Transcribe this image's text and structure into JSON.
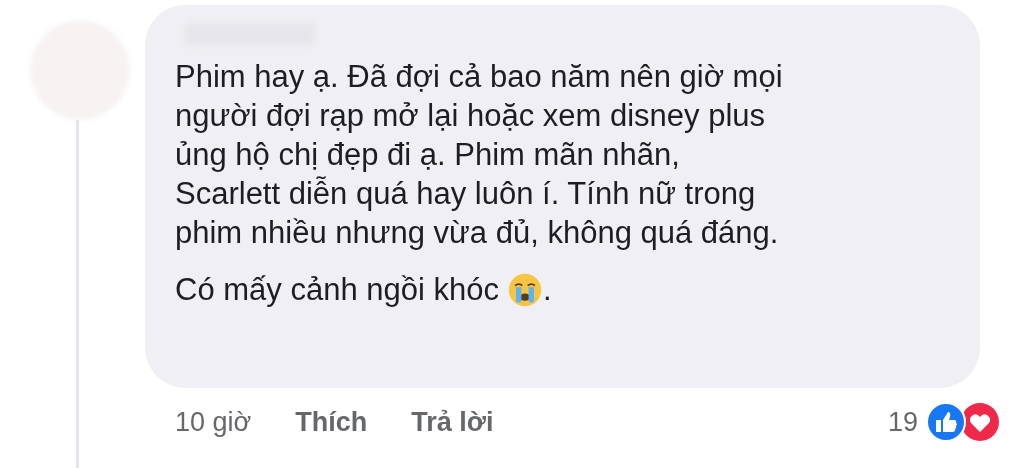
{
  "comment": {
    "body": "Phim hay ạ. Đã đợi cả bao năm nên giờ mọi\nngười đợi rạp mở lại hoặc xem disney plus\nủng hộ chị đẹp đi ạ. Phim mãn nhãn,\nScarlett diễn quá hay luôn í. Tính nữ trong\nphim nhiều nhưng vừa đủ, không quá đáng.",
    "last_line": "Có mấy cảnh ngồi khóc",
    "last_line_end": "."
  },
  "footer": {
    "time": "10 giờ",
    "actions": [
      "Thích",
      "Trả lời"
    ],
    "reaction_count": "19"
  }
}
